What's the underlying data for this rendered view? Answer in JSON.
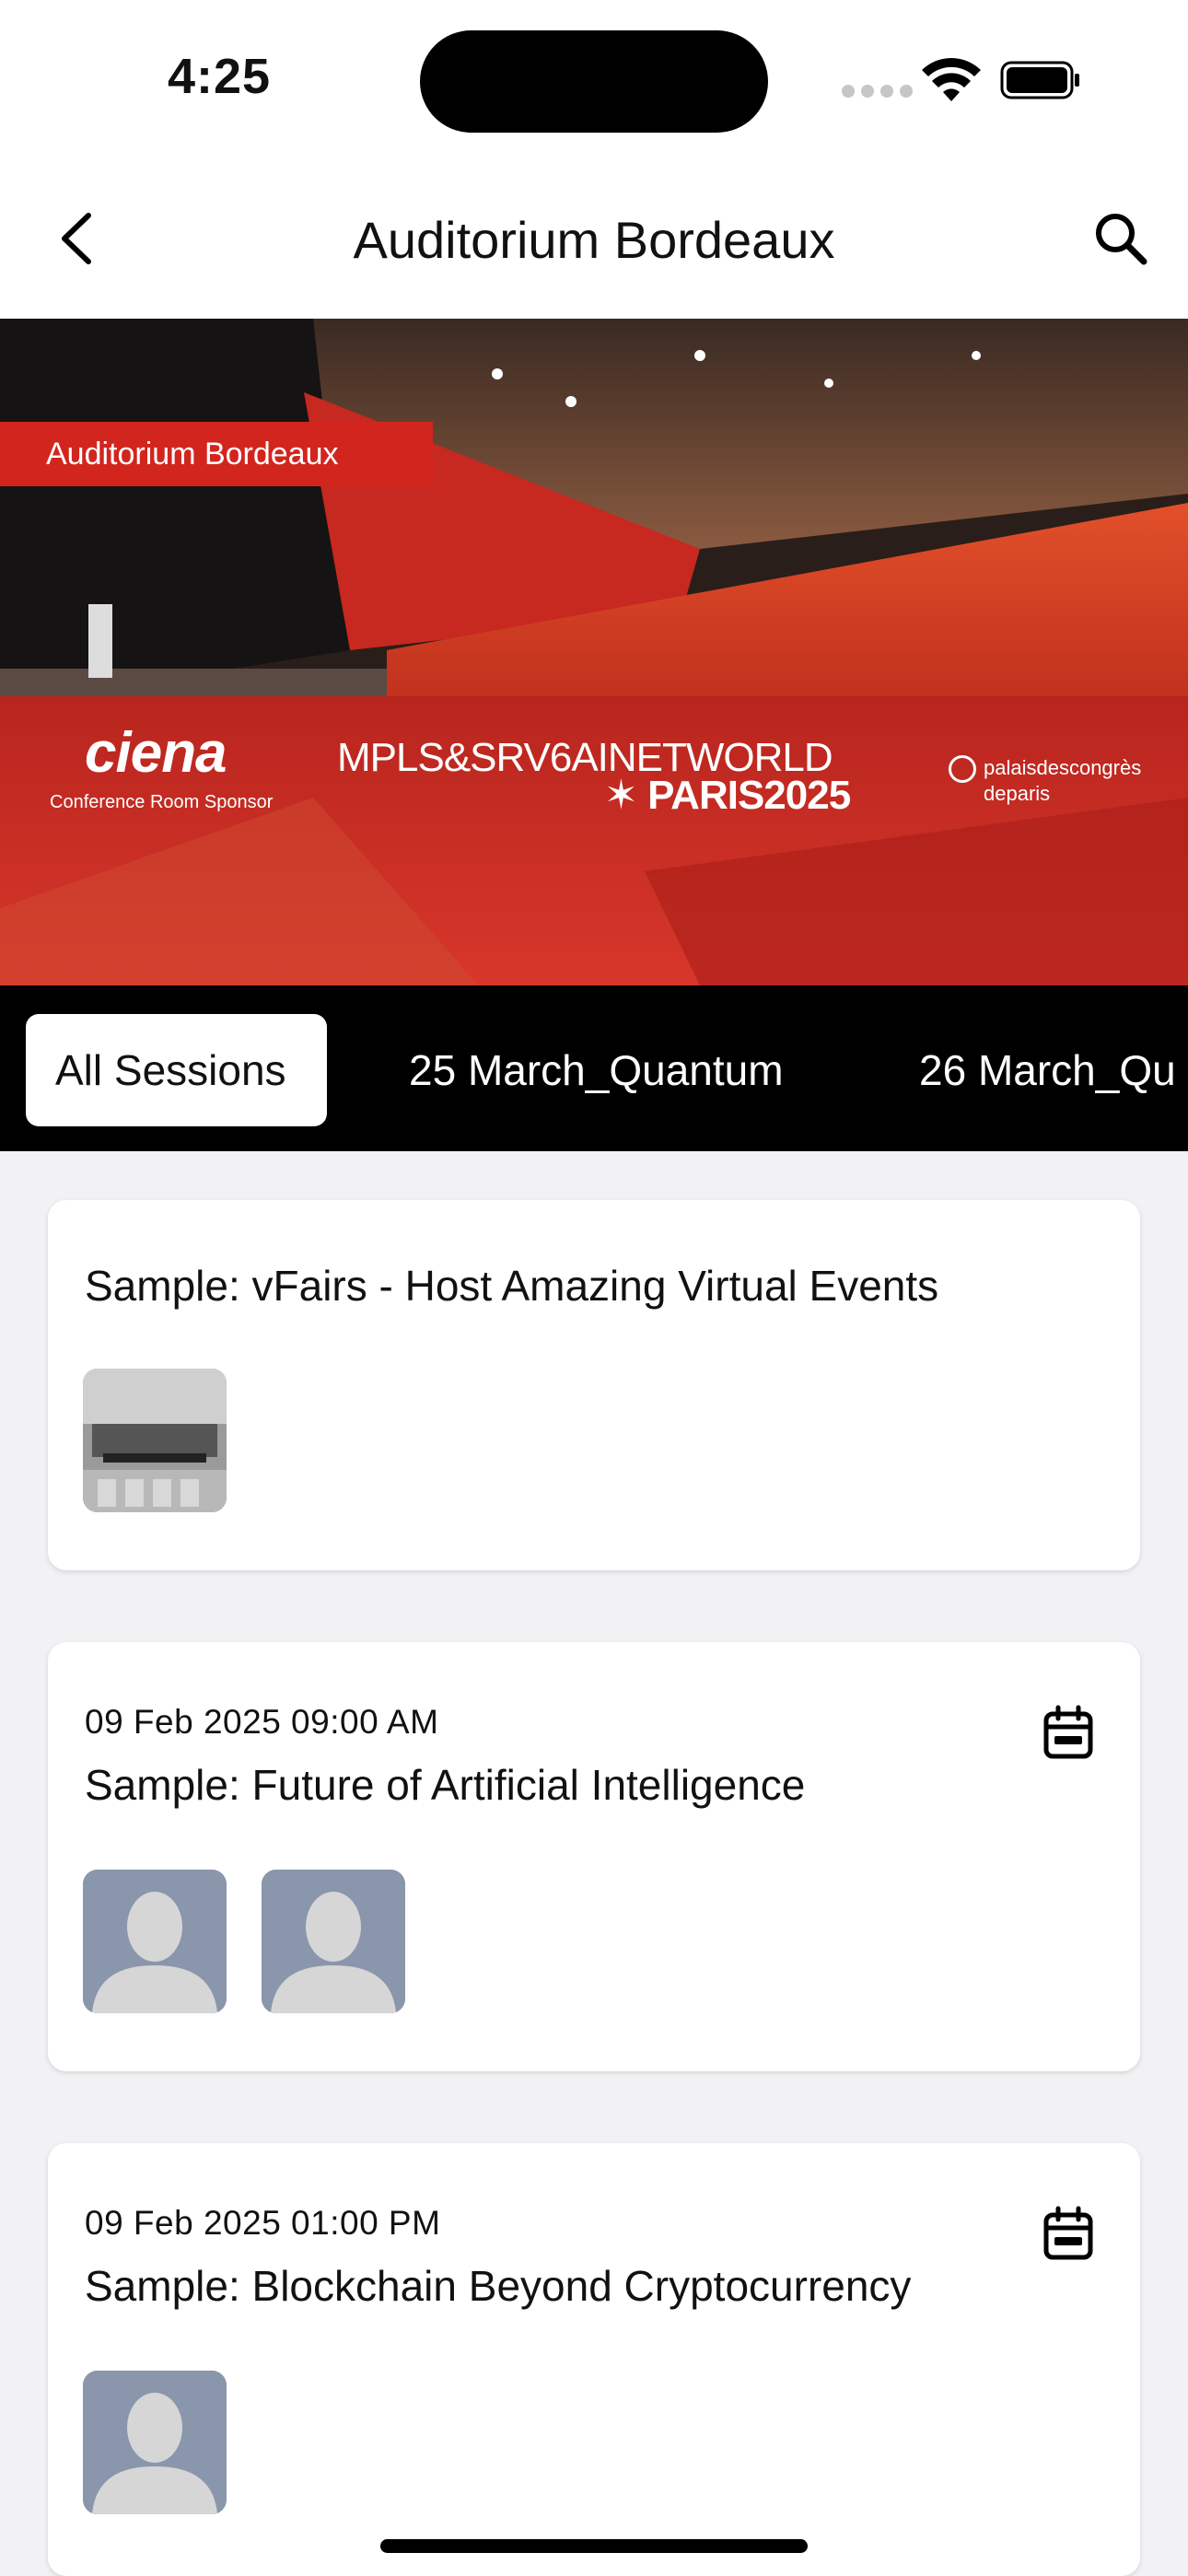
{
  "status": {
    "time": "4:25"
  },
  "nav": {
    "title": "Auditorium Bordeaux",
    "back_icon": "chevron-left-icon",
    "search_icon": "search-icon"
  },
  "banner": {
    "label": "Auditorium Bordeaux",
    "sponsor_logo": "ciena",
    "sponsor_caption": "Conference Room Sponsor",
    "event_line1": "MPLS&SRV6AINETWORLD",
    "event_line2": "✶ PARIS2025",
    "venue_line1": "palaisdescongrès",
    "venue_line2": "deparis",
    "accent_color": "#d2251e"
  },
  "tabs": [
    {
      "label": "All Sessions",
      "active": true
    },
    {
      "label": "25 March_Quantum",
      "active": false
    },
    {
      "label": "26 March_Qu",
      "active": false
    }
  ],
  "sessions": [
    {
      "date": "",
      "title": "Sample: vFairs - Host Amazing Virtual Events",
      "thumb_count": 1,
      "thumb_type": "photo"
    },
    {
      "date": "09 Feb 2025 09:00 AM",
      "title": "Sample: Future of Artificial Intelligence",
      "thumb_count": 2,
      "thumb_type": "avatar"
    },
    {
      "date": "09 Feb 2025 01:00 PM",
      "title": "Sample: Blockchain Beyond Cryptocurrency",
      "thumb_count": 1,
      "thumb_type": "avatar"
    }
  ]
}
